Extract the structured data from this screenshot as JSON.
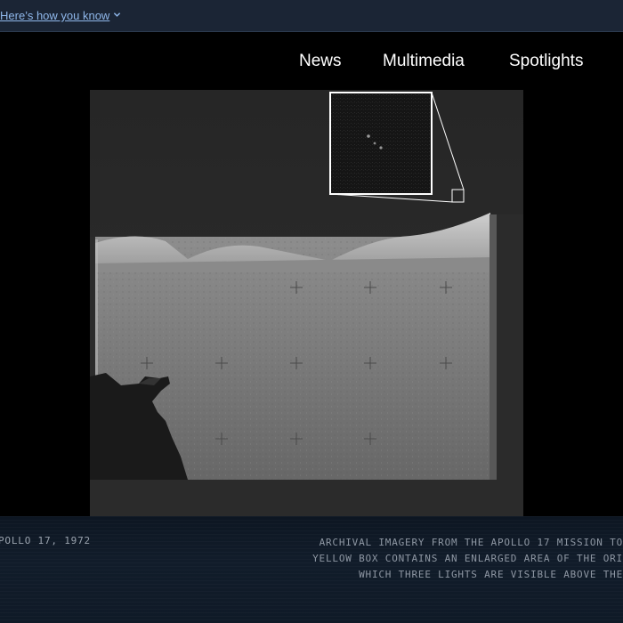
{
  "gov_banner": {
    "link_text": "Here’s how you know",
    "icon": "chevron-down-icon"
  },
  "nav": {
    "items": [
      {
        "label": "News"
      },
      {
        "label": "Multimedia"
      },
      {
        "label": "Spotlights"
      }
    ]
  },
  "photo": {
    "subject": "Apollo 17 lunar surface photograph with magnified inset",
    "inset_outline_color": "#ffffff"
  },
  "caption": {
    "credit": "POLLO 17, 1972",
    "lines": [
      "ARCHIVAL IMAGERY FROM THE APOLLO 17 MISSION TO",
      "YELLOW BOX CONTAINS AN ENLARGED AREA OF THE ORI",
      "WHICH THREE LIGHTS ARE VISIBLE ABOVE THE"
    ]
  },
  "colors": {
    "banner_bg": "#1b2535",
    "banner_link": "#8fb7ea",
    "page_bg": "#000000",
    "caption_bg": "#0f1a27",
    "caption_text": "#8e97a3"
  }
}
